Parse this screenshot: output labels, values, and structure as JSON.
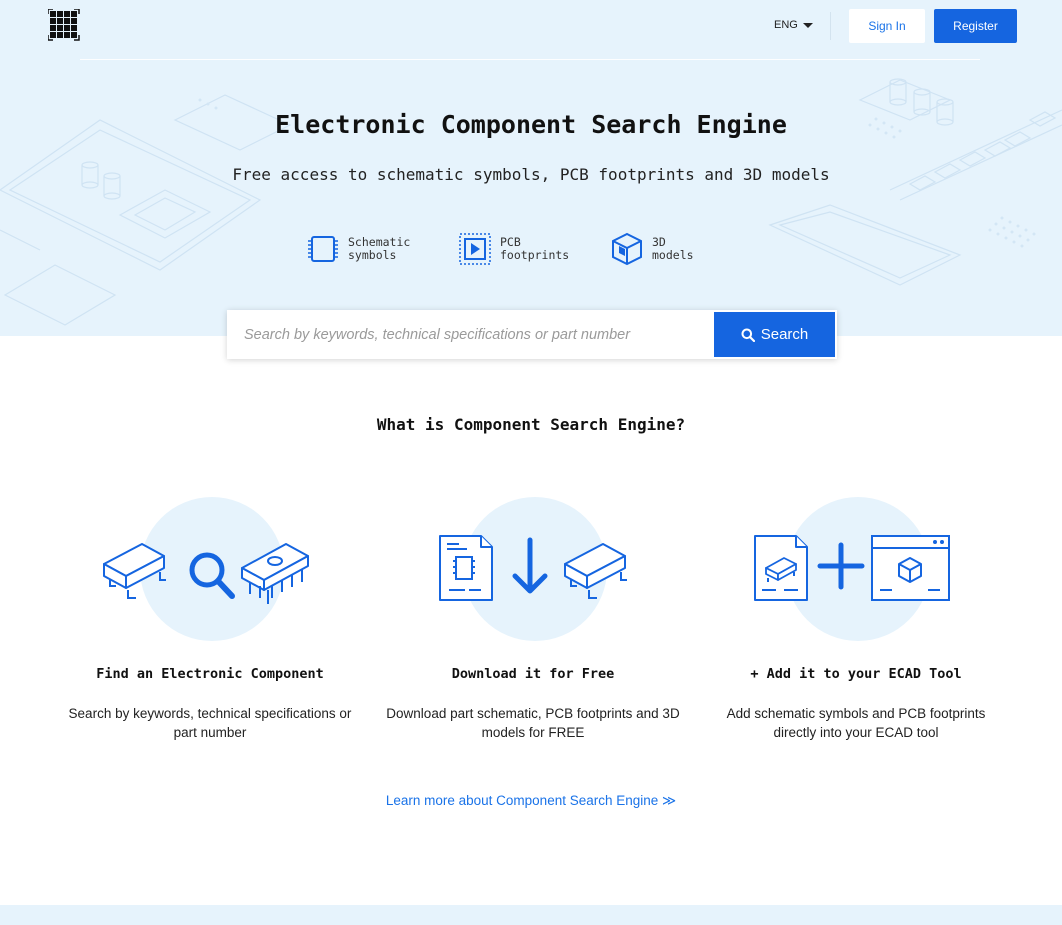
{
  "header": {
    "language": "ENG",
    "sign_in": "Sign In",
    "register": "Register"
  },
  "hero": {
    "title": "Electronic Component Search Engine",
    "subtitle": "Free access to schematic symbols, PCB footprints and 3D models",
    "features": [
      {
        "icon": "schematic-symbol-icon",
        "label": "Schematic\nsymbols"
      },
      {
        "icon": "pcb-footprint-icon",
        "label": "PCB\nfootprints"
      },
      {
        "icon": "3d-model-cube-icon",
        "label": "3D\nmodels"
      }
    ]
  },
  "search": {
    "placeholder": "Search by keywords, technical specifications or part number",
    "value": "",
    "button": "Search",
    "button_icon": "search-icon"
  },
  "what": {
    "title": "What is Component Search Engine?",
    "steps": [
      {
        "title": "Find an Electronic Component",
        "description": "Search by keywords, technical specifications or part number"
      },
      {
        "title": "Download it for Free",
        "description": "Download part schematic, PCB footprints and 3D models for FREE"
      },
      {
        "title": "+ Add it to your ECAD Tool",
        "description": "Add schematic symbols and PCB footprints directly into your ECAD tool"
      }
    ]
  },
  "learn_more": "Learn more about Component Search Engine ≫",
  "colors": {
    "accent": "#1565e0",
    "hero_background": "#e6f3fc",
    "link": "#1a73e8"
  }
}
